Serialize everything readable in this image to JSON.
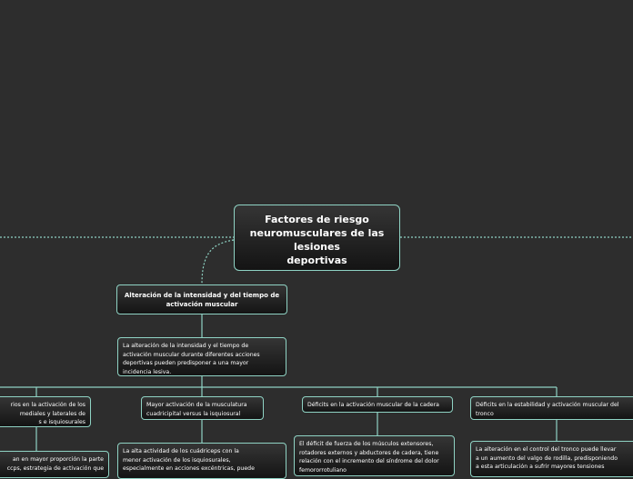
{
  "colors": {
    "background": "#2d2d2d",
    "node_border": "#8fd3c4",
    "connector": "#8fd3c4",
    "text": "#ffffff"
  },
  "central": {
    "title_line1": "Factores de riesgo",
    "title_line2": "neuromusculares de las",
    "title_line3": "lesiones",
    "title_line4": "deportivas"
  },
  "main_topic": {
    "label_line1": "Alteración de la intensidad y del tiempo de",
    "label_line2": "activación muscular"
  },
  "description": {
    "line1": "La alteración de la intensidad y el tiempo de",
    "line2": "activación muscular durante diferentes acciones",
    "line3": "deportivas pueden predisponer a una mayor",
    "line4": "incidencia lesiva."
  },
  "branches": [
    {
      "title_lines": [
        "rios en la activación de los",
        "mediales y laterales de",
        "s e isquiosurales"
      ],
      "detail_lines": [
        "an en mayor proporción la parte",
        "ccps, estrategia de activación que"
      ]
    },
    {
      "title_lines": [
        "Mayor activación de la musculatura",
        "cuadricipital versus la isquiosural"
      ],
      "detail_lines": [
        "La alta actividad de los cuádriceps con la",
        "menor activación de los isquiosurales,",
        "especialmente en acciones excéntricas, puede"
      ]
    },
    {
      "title_lines": [
        "Déficits en la activación muscular de la cadera"
      ],
      "detail_lines": [
        "El déficit de fuerza de los músculos extensores,",
        "rotadores externos y abductores de cadera, tiene",
        "relación con el incremento del síndrome del dolor",
        "femororrotuliano"
      ]
    },
    {
      "title_lines": [
        "Déficits en la estabilidad y activación muscular del",
        "tronco"
      ],
      "detail_lines": [
        "La alteración en el control del tronco puede llevar",
        "a un aumento del valgo de rodilla, predisponiendo",
        "a esta articulación a sufrir mayores tensiones"
      ]
    }
  ]
}
